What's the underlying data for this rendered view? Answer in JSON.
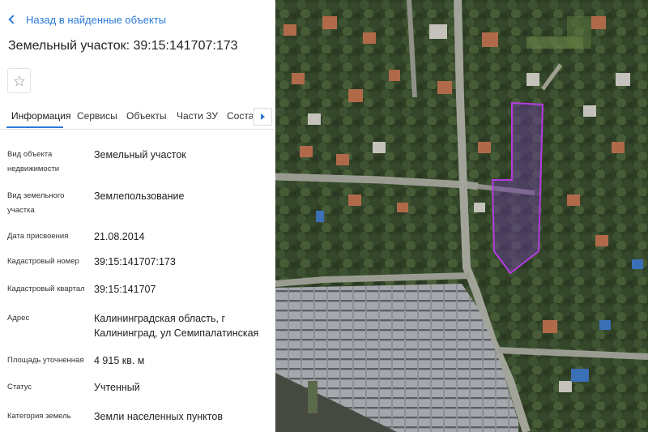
{
  "nav": {
    "back_label": "Назад в найденные объекты"
  },
  "object": {
    "title": "Земельный участок: 39:15:141707:173"
  },
  "tabs": [
    {
      "label": "Информация",
      "active": true
    },
    {
      "label": "Сервисы",
      "active": false
    },
    {
      "label": "Объекты",
      "active": false
    },
    {
      "label": "Части ЗУ",
      "active": false
    },
    {
      "label": "Состав",
      "active": false
    }
  ],
  "info": [
    {
      "label": "Вид объекта недвижимости",
      "value": "Земельный участок"
    },
    {
      "label": "Вид земельного участка",
      "value": "Землепользование"
    },
    {
      "label": "Дата присвоения",
      "value": "21.08.2014"
    },
    {
      "label": "Кадастровый номер",
      "value": "39:15:141707:173"
    },
    {
      "label": "Кадастровый квартал",
      "value": "39:15:141707"
    },
    {
      "label": "Адрес",
      "value": "Калининградская область, г Калининград, ул Семипалатинская"
    },
    {
      "label": "Площадь уточненная",
      "value": "4 915 кв. м"
    },
    {
      "label": "Статус",
      "value": "Учтенный"
    },
    {
      "label": "Категория земель",
      "value": "Земли населенных пунктов"
    }
  ],
  "colors": {
    "accent": "#2b7ad6",
    "parcel_outline": "#b53be0",
    "parcel_fill": "#6a3aa0"
  },
  "icons": {
    "back": "chevron-left-icon",
    "favorite": "star-outline-icon",
    "tabs_next": "triangle-right-icon"
  }
}
